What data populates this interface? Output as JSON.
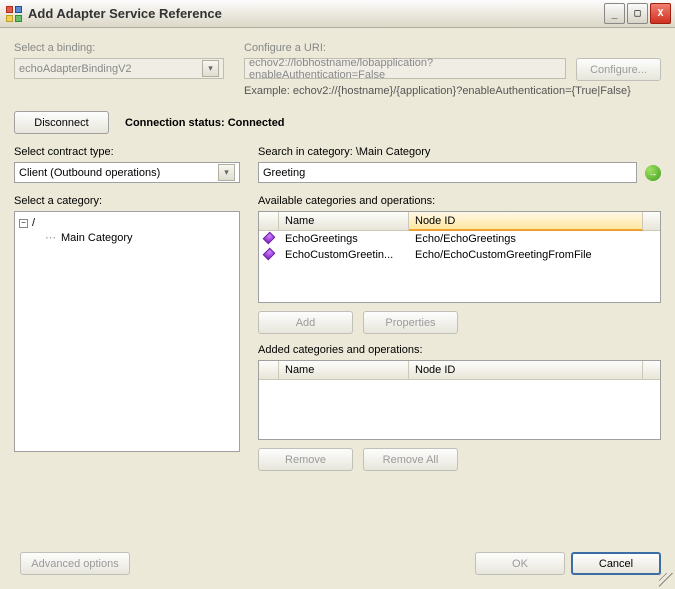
{
  "window": {
    "title": "Add Adapter Service Reference"
  },
  "binding": {
    "label": "Select a binding:",
    "value": "echoAdapterBindingV2"
  },
  "uri": {
    "label": "Configure a URI:",
    "value": "echov2://lobhostname/lobapplication?enableAuthentication=False",
    "configure_button": "Configure...",
    "example": "Example: echov2://{hostname}/{application}?enableAuthentication={True|False}"
  },
  "connection": {
    "disconnect_button": "Disconnect",
    "status_label": "Connection status:",
    "status_value": "Connected"
  },
  "contract": {
    "label": "Select contract type:",
    "value": "Client (Outbound operations)"
  },
  "search": {
    "label": "Search in category: \\Main Category",
    "value": "Greeting"
  },
  "category_tree": {
    "label": "Select a category:",
    "root": "/",
    "child": "Main Category"
  },
  "available": {
    "label": "Available categories and operations:",
    "col_name": "Name",
    "col_node": "Node ID",
    "rows": [
      {
        "name": "EchoGreetings",
        "node": "Echo/EchoGreetings"
      },
      {
        "name": "EchoCustomGreetin...",
        "node": "Echo/EchoCustomGreetingFromFile"
      }
    ],
    "add_button": "Add",
    "properties_button": "Properties"
  },
  "added": {
    "label": "Added categories and operations:",
    "col_name": "Name",
    "col_node": "Node ID",
    "remove_button": "Remove",
    "remove_all_button": "Remove All"
  },
  "footer": {
    "advanced_button": "Advanced options",
    "ok_button": "OK",
    "cancel_button": "Cancel"
  }
}
